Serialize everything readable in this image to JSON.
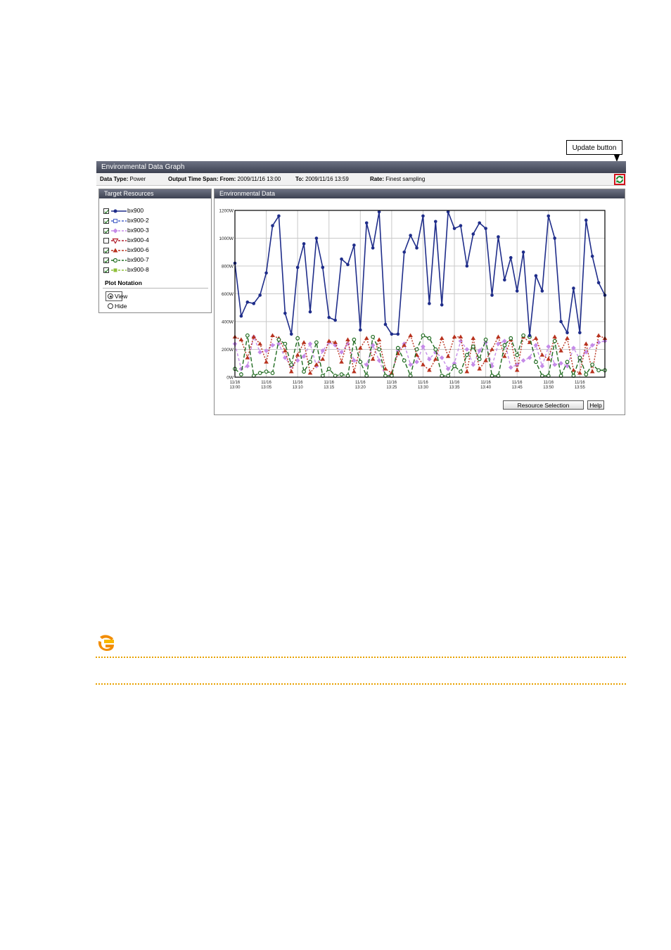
{
  "callout": {
    "label": "Update button"
  },
  "window": {
    "title": "Environmental Data Graph",
    "info": {
      "data_type_label": "Data Type:",
      "data_type_value": "Power",
      "span_label": "Output Time Span:",
      "from_label": "From:",
      "from_value": "2009/11/16 13:00",
      "to_label": "To:",
      "to_value": "2009/11/16 13:59",
      "rate_label": "Rate:",
      "rate_value": "Finest sampling"
    }
  },
  "target_resources": {
    "title": "Target Resources",
    "items": [
      {
        "label": "bx900",
        "checked": true,
        "color": "#1f2d8a",
        "marker": "circle"
      },
      {
        "label": "bx900-2",
        "checked": true,
        "color": "#4a64c8",
        "marker": "square-open"
      },
      {
        "label": "bx900-3",
        "checked": true,
        "color": "#c58be8",
        "marker": "diamond"
      },
      {
        "label": "bx900-4",
        "checked": false,
        "color": "#b01c2a",
        "marker": "triangle-down-open"
      },
      {
        "label": "bx900-6",
        "checked": true,
        "color": "#b8321e",
        "marker": "triangle"
      },
      {
        "label": "bx900-7",
        "checked": true,
        "color": "#1f6b1f",
        "marker": "circle-open"
      },
      {
        "label": "bx900-8",
        "checked": true,
        "color": "#8fbf3a",
        "marker": "square"
      }
    ],
    "plot_notation": {
      "title": "Plot Notation",
      "options": [
        {
          "label": "View",
          "selected": true
        },
        {
          "label": "Hide",
          "selected": false
        }
      ]
    }
  },
  "env_panel": {
    "title": "Environmental Data",
    "buttons": {
      "resource_selection": "Resource Selection",
      "help": "Help"
    }
  },
  "chart_data": {
    "type": "line",
    "title": "",
    "xlabel": "",
    "ylabel": "",
    "ylim": [
      0,
      1200
    ],
    "yticks": [
      "0W",
      "200W",
      "400W",
      "600W",
      "800W",
      "1000W",
      "1200W"
    ],
    "xticks": [
      {
        "date": "11/16",
        "time": "13:00"
      },
      {
        "date": "11/16",
        "time": "13:05"
      },
      {
        "date": "11/16",
        "time": "13:10"
      },
      {
        "date": "11/16",
        "time": "13:15"
      },
      {
        "date": "11/16",
        "time": "13:20"
      },
      {
        "date": "11/16",
        "time": "13:25"
      },
      {
        "date": "11/16",
        "time": "13:30"
      },
      {
        "date": "11/16",
        "time": "13:35"
      },
      {
        "date": "11/16",
        "time": "13:40"
      },
      {
        "date": "11/16",
        "time": "13:45"
      },
      {
        "date": "11/16",
        "time": "13:50"
      },
      {
        "date": "11/16",
        "time": "13:55"
      }
    ],
    "x_minutes": [
      0,
      1,
      2,
      3,
      4,
      5,
      6,
      7,
      8,
      9,
      10,
      11,
      12,
      13,
      14,
      15,
      16,
      17,
      18,
      19,
      20,
      21,
      22,
      23,
      24,
      25,
      26,
      27,
      28,
      29,
      30,
      31,
      32,
      33,
      34,
      35,
      36,
      37,
      38,
      39,
      40,
      41,
      42,
      43,
      44,
      45,
      46,
      47,
      48,
      49,
      50,
      51,
      52,
      53,
      54,
      55,
      56,
      57,
      58,
      59
    ],
    "grid": true,
    "series": [
      {
        "name": "bx900",
        "color": "#1f2d8a",
        "dash": "solid",
        "marker": "circle",
        "values": [
          820,
          440,
          540,
          530,
          590,
          750,
          1090,
          1160,
          460,
          310,
          790,
          960,
          470,
          1000,
          790,
          430,
          410,
          850,
          810,
          950,
          340,
          1110,
          930,
          1190,
          380,
          310,
          310,
          900,
          1020,
          930,
          1160,
          530,
          1120,
          520,
          1190,
          1070,
          1090,
          800,
          1030,
          1110,
          1070,
          590,
          1010,
          700,
          860,
          620,
          900,
          300,
          730,
          620,
          1160,
          1000,
          400,
          320,
          640,
          320,
          1130,
          870,
          680,
          590
        ]
      },
      {
        "name": "bx900-3",
        "color": "#c58be8",
        "dash": "4,3",
        "marker": "diamond",
        "values": [
          240,
          60,
          80,
          290,
          180,
          190,
          230,
          240,
          140,
          80,
          120,
          150,
          240,
          80,
          190,
          250,
          230,
          180,
          240,
          120,
          110,
          90,
          230,
          120,
          10,
          20,
          190,
          240,
          90,
          110,
          220,
          130,
          180,
          140,
          60,
          100,
          260,
          200,
          90,
          190,
          250,
          80,
          240,
          260,
          70,
          90,
          120,
          140,
          230,
          80,
          220,
          90,
          100,
          80,
          210,
          130,
          180,
          230,
          250,
          260
        ]
      },
      {
        "name": "bx900-6",
        "color": "#b8321e",
        "dash": "2,2",
        "marker": "triangle",
        "values": [
          290,
          270,
          140,
          290,
          240,
          110,
          300,
          280,
          190,
          40,
          160,
          250,
          30,
          90,
          130,
          260,
          250,
          110,
          270,
          40,
          210,
          280,
          130,
          270,
          60,
          30,
          170,
          230,
          300,
          160,
          90,
          50,
          130,
          280,
          150,
          290,
          290,
          40,
          280,
          60,
          120,
          200,
          290,
          150,
          270,
          50,
          290,
          250,
          280,
          160,
          130,
          290,
          190,
          280,
          50,
          30,
          240,
          40,
          300,
          280
        ]
      },
      {
        "name": "bx900-7",
        "color": "#1f6b1f",
        "dash": "6,3",
        "marker": "circle-open",
        "values": [
          60,
          20,
          300,
          10,
          30,
          40,
          30,
          270,
          240,
          90,
          280,
          40,
          110,
          250,
          10,
          60,
          10,
          20,
          10,
          270,
          110,
          10,
          290,
          200,
          10,
          10,
          210,
          120,
          10,
          200,
          300,
          280,
          200,
          10,
          10,
          80,
          40,
          160,
          220,
          130,
          270,
          10,
          10,
          230,
          280,
          160,
          300,
          290,
          110,
          10,
          10,
          260,
          10,
          110,
          10,
          140,
          20,
          90,
          50,
          50
        ]
      }
    ]
  }
}
